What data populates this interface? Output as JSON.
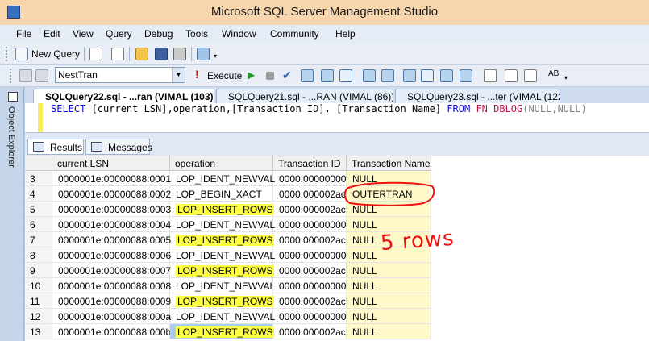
{
  "window": {
    "title": "Microsoft SQL Server Management Studio"
  },
  "menu": {
    "items": [
      "File",
      "Edit",
      "View",
      "Query",
      "Debug",
      "Tools",
      "Window",
      "Community",
      "Help"
    ]
  },
  "toolbar1": {
    "new_query_label": "New Query"
  },
  "toolbar2": {
    "database_selected": "NestTran",
    "execute_label": "Execute"
  },
  "side_panel": {
    "label": "Object Explorer"
  },
  "doc_tabs": [
    {
      "label": "SQLQuery22.sql - ...ran (VIMAL (103))*",
      "active": true
    },
    {
      "label": "SQLQuery21.sql - ...RAN (VIMAL (86))*",
      "active": false
    },
    {
      "label": "SQLQuery23.sql - ...ter (VIMAL (122))",
      "active": false
    }
  ],
  "editor": {
    "kw_select": "SELECT",
    "columns_text": " [current LSN],operation,[Transaction ID], [Transaction Name] ",
    "kw_from": "FROM",
    "fn_name": "FN_DBLOG",
    "args": "(NULL,NULL)"
  },
  "results_tabs": {
    "results": "Results",
    "messages": "Messages"
  },
  "grid": {
    "columns": [
      "current LSN",
      "operation",
      "Transaction ID",
      "Transaction Name"
    ],
    "rows": [
      {
        "n": "3",
        "lsn": "0000001e:00000088:0001",
        "op": "LOP_IDENT_NEWVAL",
        "tid": "0000:00000000",
        "tname": "NULL",
        "hl": false,
        "sel": false
      },
      {
        "n": "4",
        "lsn": "0000001e:00000088:0002",
        "op": "LOP_BEGIN_XACT",
        "tid": "0000:000002ac",
        "tname": "OUTERTRAN",
        "hl": false,
        "sel": false
      },
      {
        "n": "5",
        "lsn": "0000001e:00000088:0003",
        "op": "LOP_INSERT_ROWS",
        "tid": "0000:000002ac",
        "tname": "NULL",
        "hl": true,
        "sel": false
      },
      {
        "n": "6",
        "lsn": "0000001e:00000088:0004",
        "op": "LOP_IDENT_NEWVAL",
        "tid": "0000:00000000",
        "tname": "NULL",
        "hl": false,
        "sel": false
      },
      {
        "n": "7",
        "lsn": "0000001e:00000088:0005",
        "op": "LOP_INSERT_ROWS",
        "tid": "0000:000002ac",
        "tname": "NULL",
        "hl": true,
        "sel": false
      },
      {
        "n": "8",
        "lsn": "0000001e:00000088:0006",
        "op": "LOP_IDENT_NEWVAL",
        "tid": "0000:00000000",
        "tname": "NULL",
        "hl": false,
        "sel": false
      },
      {
        "n": "9",
        "lsn": "0000001e:00000088:0007",
        "op": "LOP_INSERT_ROWS",
        "tid": "0000:000002ac",
        "tname": "NULL",
        "hl": true,
        "sel": false
      },
      {
        "n": "10",
        "lsn": "0000001e:00000088:0008",
        "op": "LOP_IDENT_NEWVAL",
        "tid": "0000:00000000",
        "tname": "NULL",
        "hl": false,
        "sel": false
      },
      {
        "n": "11",
        "lsn": "0000001e:00000088:0009",
        "op": "LOP_INSERT_ROWS",
        "tid": "0000:000002ac",
        "tname": "NULL",
        "hl": true,
        "sel": false
      },
      {
        "n": "12",
        "lsn": "0000001e:00000088:000a",
        "op": "LOP_IDENT_NEWVAL",
        "tid": "0000:00000000",
        "tname": "NULL",
        "hl": false,
        "sel": false
      },
      {
        "n": "13",
        "lsn": "0000001e:00000088:000b",
        "op": "LOP_INSERT_ROWS",
        "tid": "0000:000002ac",
        "tname": "NULL",
        "hl": true,
        "sel": true
      }
    ]
  },
  "annotation": {
    "text": "5 rows",
    "color": "#ee1111"
  },
  "colors": {
    "highlight": "#ffff44",
    "selection": "#a8cff2",
    "title_bar": "#f7d6ad"
  }
}
